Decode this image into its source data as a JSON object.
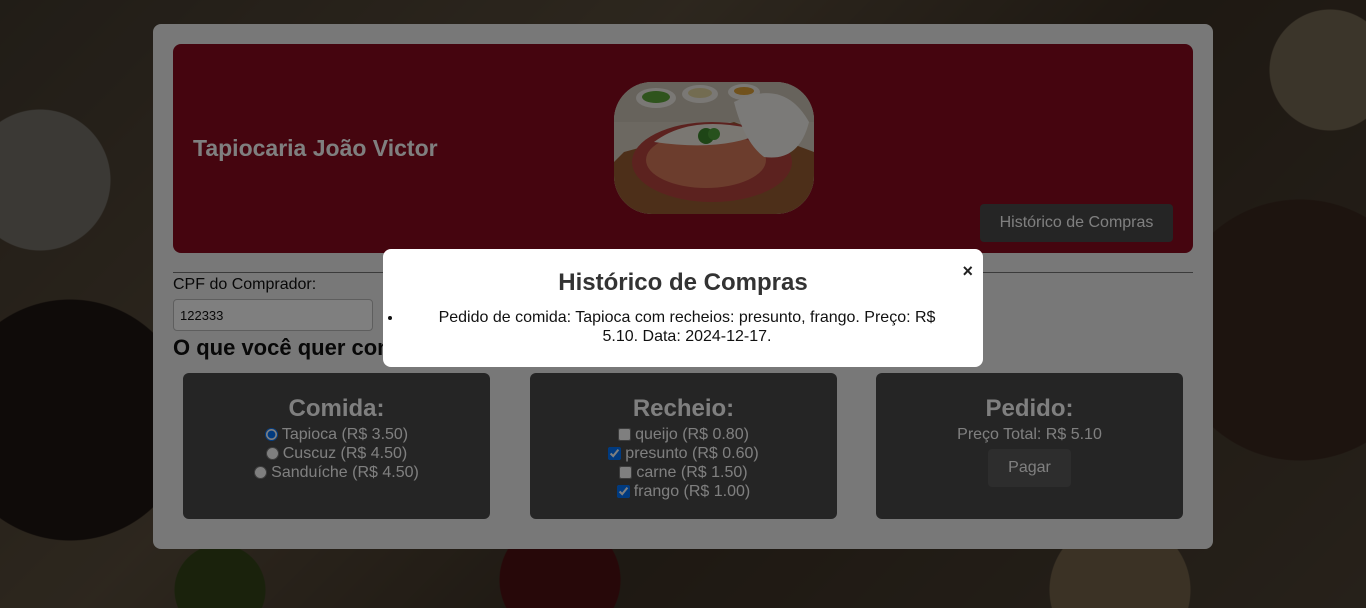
{
  "brand": "Tapiocaria João Victor",
  "header": {
    "history_button": "Histórico de Compras"
  },
  "cpf": {
    "label": "CPF do Comprador:",
    "value": "122333"
  },
  "question": "O que você quer comer?",
  "food_card": {
    "title": "Comida:",
    "options": [
      {
        "label": "Tapioca (R$ 3.50)",
        "selected": true
      },
      {
        "label": "Cuscuz (R$ 4.50)",
        "selected": false
      },
      {
        "label": "Sanduíche (R$ 4.50)",
        "selected": false
      }
    ]
  },
  "filling_card": {
    "title": "Recheio:",
    "options": [
      {
        "label": "queijo (R$ 0.80)",
        "checked": false
      },
      {
        "label": "presunto (R$ 0.60)",
        "checked": true
      },
      {
        "label": "carne (R$ 1.50)",
        "checked": false
      },
      {
        "label": "frango (R$ 1.00)",
        "checked": true
      }
    ]
  },
  "order_card": {
    "title": "Pedido:",
    "total": "Preço Total: R$ 5.10",
    "pay_button": "Pagar"
  },
  "modal": {
    "title": "Histórico de Compras",
    "close": "×",
    "entries": [
      "Pedido de comida: Tapioca com recheios: presunto, frango. Preço: R$ 5.10. Data: 2024-12-17."
    ]
  },
  "colors": {
    "header_bg": "#8b0a1e",
    "card_bg": "#4a4a4a",
    "container_bg": "#f0f0f0"
  }
}
